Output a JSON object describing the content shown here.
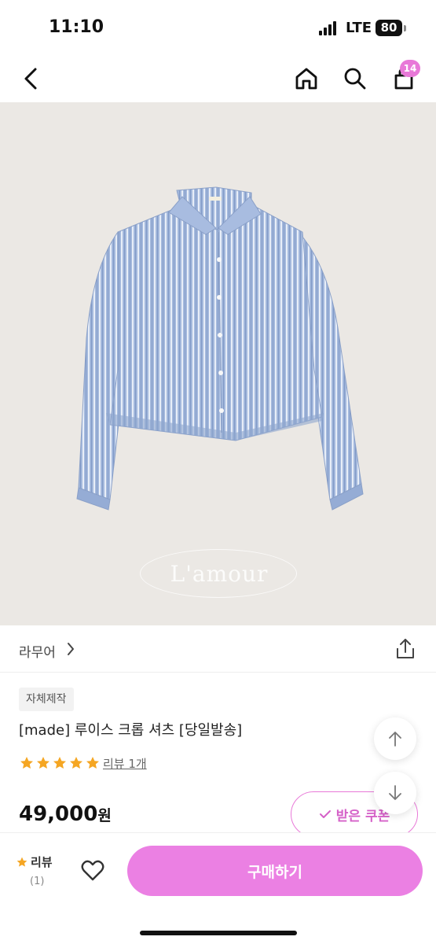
{
  "status": {
    "time": "11:10",
    "network": "LTE",
    "battery": "80"
  },
  "nav": {
    "cart_count": "14",
    "icons": [
      "back-icon",
      "home-icon",
      "search-icon",
      "cart-icon"
    ]
  },
  "hero": {
    "watermark": "L'amour"
  },
  "store": {
    "name": "라무어"
  },
  "product": {
    "tag": "자체제작",
    "title": "[made] 루이스 크롭 셔츠 [당일발송]",
    "rating": 5,
    "review_link": "리뷰 1개",
    "price": "49,000",
    "price_unit": "원"
  },
  "coupon": {
    "label": "받은 쿠폰"
  },
  "bottom_bar": {
    "review_label": "리뷰",
    "review_count": "(1)",
    "buy_label": "구매하기"
  },
  "colors": {
    "accent": "#eb80e3",
    "star": "#f5a623",
    "hero_bg": "#ebe8e4",
    "shirt": "#9fb6da"
  }
}
